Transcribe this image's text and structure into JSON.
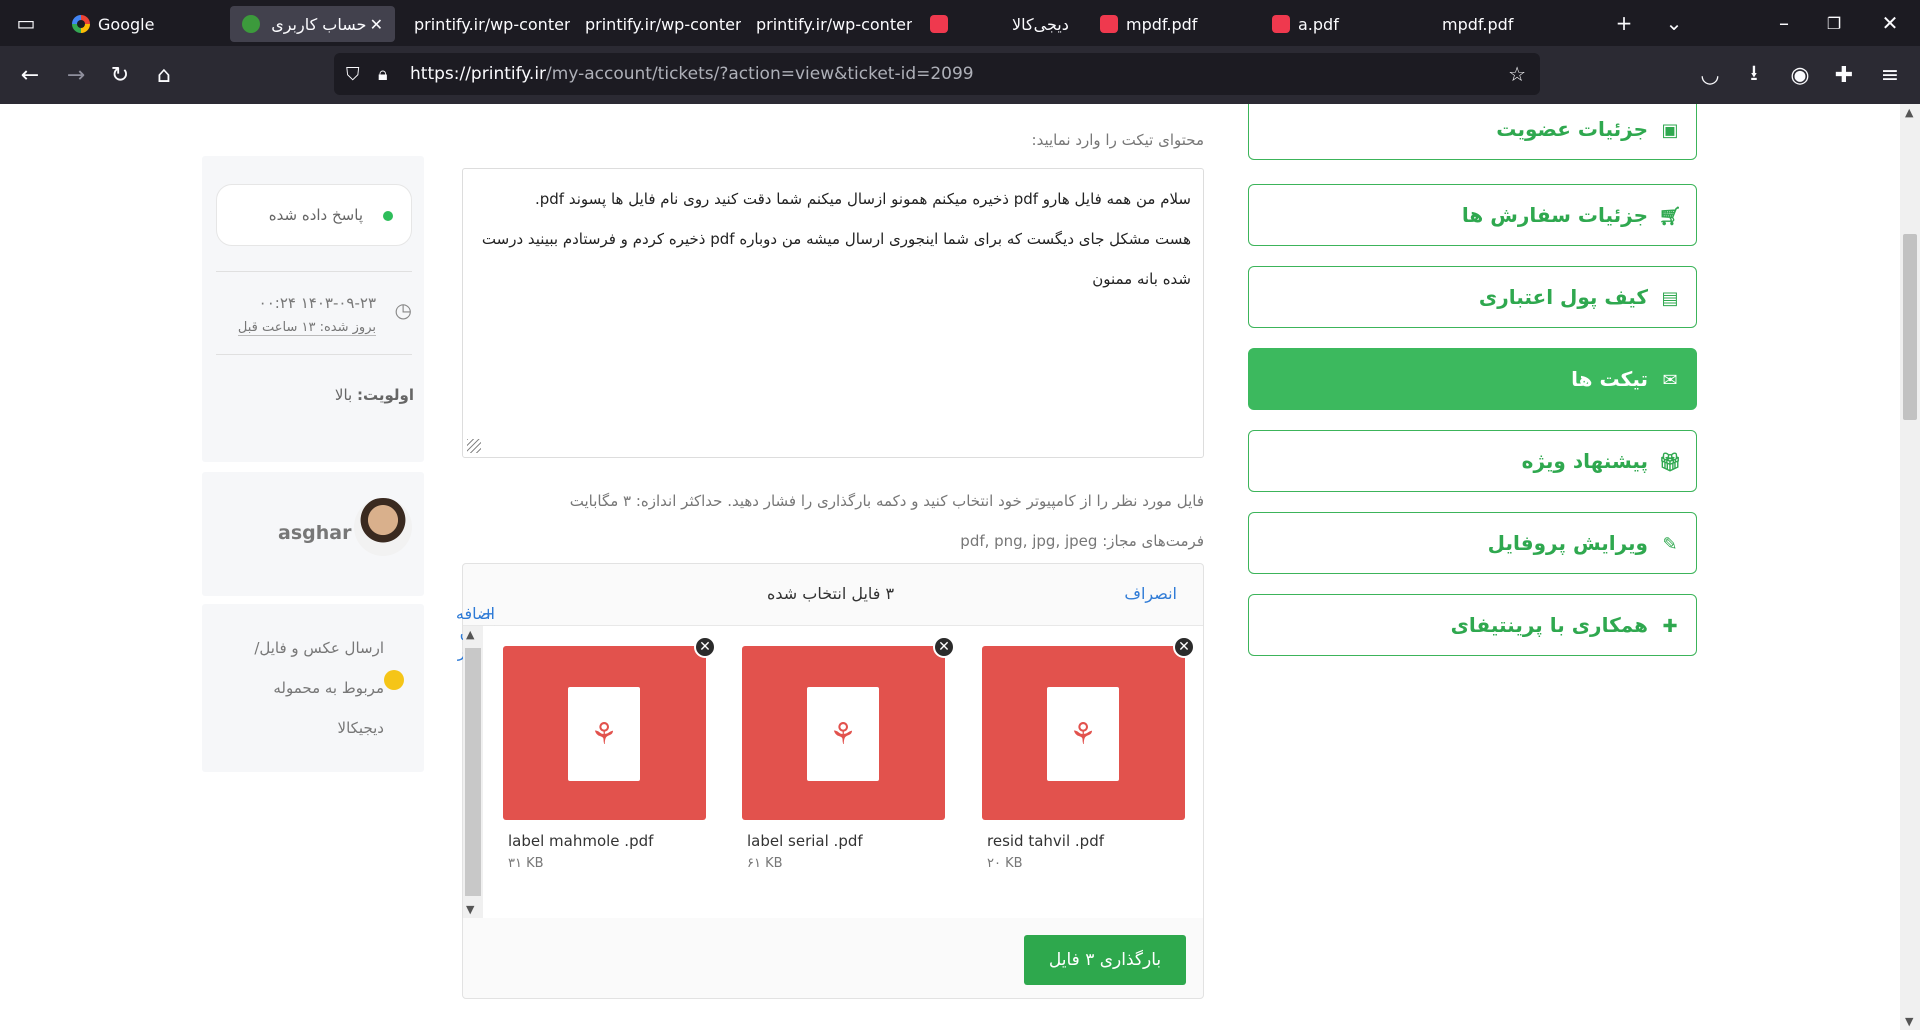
{
  "browser": {
    "tabs": [
      {
        "label": "Google",
        "favicon": "google-icon"
      },
      {
        "label": "حساب کاربری",
        "favicon": "bug-icon",
        "active": true
      },
      {
        "label": "printify.ir/wp-content",
        "favicon": ""
      },
      {
        "label": "printify.ir/wp-content",
        "favicon": ""
      },
      {
        "label": "printify.ir/wp-content",
        "favicon": ""
      },
      {
        "label": "",
        "favicon": "digikala-icon"
      },
      {
        "label": "دیجی‌کالا",
        "favicon": ""
      },
      {
        "label": "mpdf.pdf",
        "favicon": "digikala-icon"
      },
      {
        "label": "a.pdf",
        "favicon": "digikala-icon"
      },
      {
        "label": "mpdf.pdf",
        "favicon": ""
      }
    ],
    "url_host": "https://printify.ir",
    "url_path": "/my-account/tickets/?action=view&ticket-id=2099"
  },
  "menu": {
    "items": [
      {
        "label": "جزئیات عضویت",
        "icon": "id-card-icon"
      },
      {
        "label": "جزئیات سفارش ها",
        "icon": "cart-icon"
      },
      {
        "label": "کیف پول اعتباری",
        "icon": "money-icon"
      },
      {
        "label": "تیکت ها",
        "icon": "envelope-icon",
        "active": true
      },
      {
        "label": "پیشنهاد ویژه",
        "icon": "gift-icon"
      },
      {
        "label": "ویرایش پروفایل",
        "icon": "pencil-icon"
      },
      {
        "label": "همکاری با پرینتیفای",
        "icon": "plus-icon"
      }
    ],
    "accent": "#3cb95e"
  },
  "ticket": {
    "content_label": "محتوای تیکت را وارد نمایید:",
    "message_lines": [
      "سلام من همه فایل هارو pdf ذخیره میکنم همونو ازسال میکنم شما دقت کنید روی نام فایل ها پسوند pdf.",
      "هست مشکل جای دیگست که برای شما اینجوری ارسال میشه من دوباره pdf ذخیره کردم و فرستادم ببینید درست",
      "شده بانه ممنون"
    ],
    "file_hint": "فایل مورد نظر را از کامپیوتر خود انتخاب کنید و دکمه بارگذاری را فشار دهید. حداکثر اندازه: ۳ مگابایت",
    "formats": "فرمت‌های مجاز: pdf, png, jpg, jpeg"
  },
  "uploader": {
    "cancel": "انصراف",
    "selected": "۳ فایل انتخاب شده",
    "add_more": "اضافه کردن بیشتر",
    "files": [
      {
        "name": "resid tahvil .pdf",
        "size": "۲۰ KB"
      },
      {
        "name": "label serial .pdf",
        "size": "۶۱ KB"
      },
      {
        "name": "label mahmole .pdf",
        "size": "۳۱ KB"
      }
    ],
    "upload_button": "بارگذاری ۳ فایل"
  },
  "sidebar": {
    "status": "پاسخ داده شده",
    "date": "۱۴۰۳-۰۹-۲۳ ۰۰:۲۴",
    "updated": "بروز شده: ۱۳ ساعت قبل",
    "priority_label": "اولویت:",
    "priority_value": "بالا",
    "user": "asghar",
    "note_lines": [
      "ارسال عکس و فایل/",
      "مربوط به محموله",
      "دیجیکالا"
    ]
  }
}
